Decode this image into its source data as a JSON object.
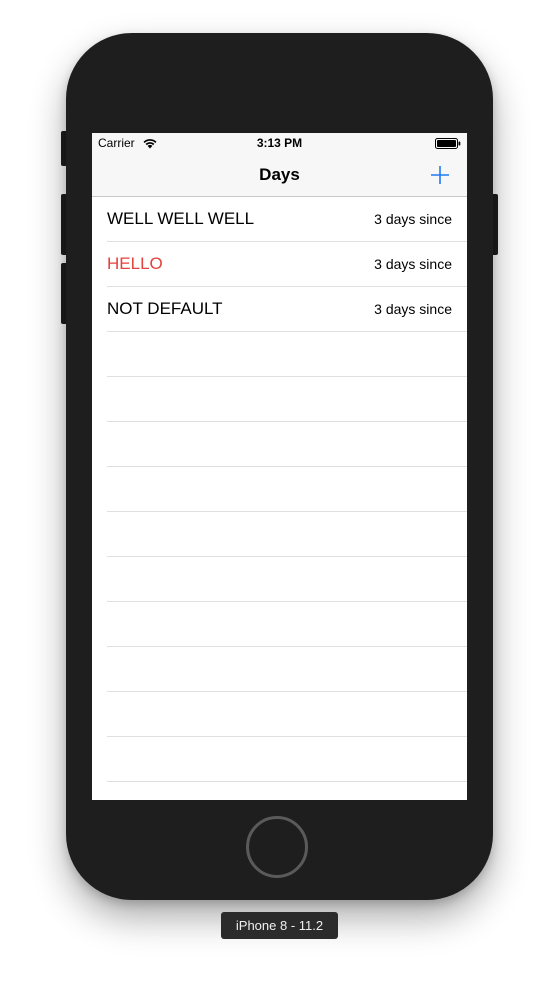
{
  "status_bar": {
    "carrier": "Carrier",
    "time": "3:13 PM",
    "wifi_icon": "wifi-icon",
    "battery_icon": "battery-full-icon"
  },
  "nav_bar": {
    "title": "Days",
    "add_icon": "plus-icon",
    "accent_color": "#1e7cf2"
  },
  "rows": [
    {
      "title": "WELL WELL WELL",
      "detail": "3 days since",
      "title_color": "#000000"
    },
    {
      "title": "HELLO",
      "detail": "3 days since",
      "title_color": "#e3413b"
    },
    {
      "title": "NOT DEFAULT",
      "detail": "3 days since",
      "title_color": "#000000"
    }
  ],
  "device_label": "iPhone 8 - 11.2"
}
